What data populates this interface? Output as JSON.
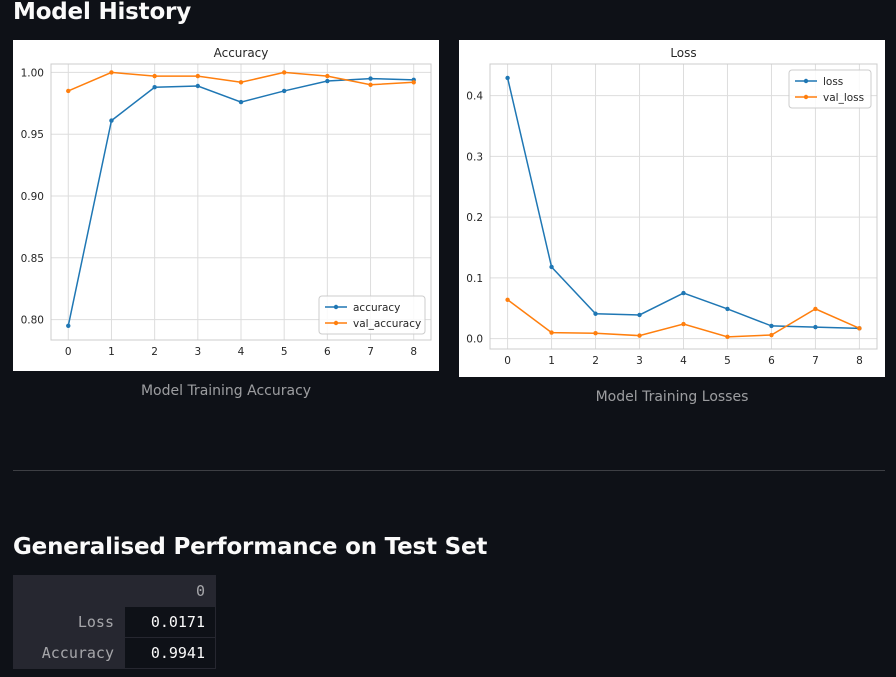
{
  "sections": {
    "history_title": "Model History",
    "performance_title": "Generalised Performance on Test Set"
  },
  "charts": [
    {
      "caption": "Model Training Accuracy"
    },
    {
      "caption": "Model Training Losses"
    }
  ],
  "chart_data": [
    {
      "type": "line",
      "title": "Accuracy",
      "xlabel": "",
      "ylabel": "",
      "x": [
        0,
        1,
        2,
        3,
        4,
        5,
        6,
        7,
        8
      ],
      "xlim": [
        -0.4,
        8.4
      ],
      "ylim": [
        0.7835,
        1.0068
      ],
      "xticks": [
        "0",
        "1",
        "2",
        "3",
        "4",
        "5",
        "6",
        "7",
        "8"
      ],
      "yticks": [
        "0.80",
        "0.85",
        "0.90",
        "0.95",
        "1.00"
      ],
      "grid": true,
      "legend_position": "lower-right",
      "series": [
        {
          "name": "accuracy",
          "color": "#1f77b4",
          "values": [
            0.795,
            0.961,
            0.988,
            0.989,
            0.976,
            0.985,
            0.993,
            0.995,
            0.994
          ]
        },
        {
          "name": "val_accuracy",
          "color": "#ff7f0e",
          "values": [
            0.985,
            1.0,
            0.997,
            0.997,
            0.992,
            1.0,
            0.997,
            0.99,
            0.992
          ]
        }
      ]
    },
    {
      "type": "line",
      "title": "Loss",
      "xlabel": "",
      "ylabel": "",
      "x": [
        0,
        1,
        2,
        3,
        4,
        5,
        6,
        7,
        8
      ],
      "xlim": [
        -0.4,
        8.4
      ],
      "ylim": [
        -0.017,
        0.452
      ],
      "xticks": [
        "0",
        "1",
        "2",
        "3",
        "4",
        "5",
        "6",
        "7",
        "8"
      ],
      "yticks": [
        "0.0",
        "0.1",
        "0.2",
        "0.3",
        "0.4"
      ],
      "grid": true,
      "legend_position": "upper-right",
      "series": [
        {
          "name": "loss",
          "color": "#1f77b4",
          "values": [
            0.429,
            0.118,
            0.041,
            0.039,
            0.075,
            0.049,
            0.021,
            0.019,
            0.017
          ]
        },
        {
          "name": "val_loss",
          "color": "#ff7f0e",
          "values": [
            0.064,
            0.01,
            0.009,
            0.005,
            0.024,
            0.003,
            0.006,
            0.049,
            0.017
          ]
        }
      ]
    }
  ],
  "performance_table": {
    "column_header": "0",
    "rows": [
      {
        "label": "Loss",
        "value": "0.0171"
      },
      {
        "label": "Accuracy",
        "value": "0.9941"
      }
    ]
  }
}
